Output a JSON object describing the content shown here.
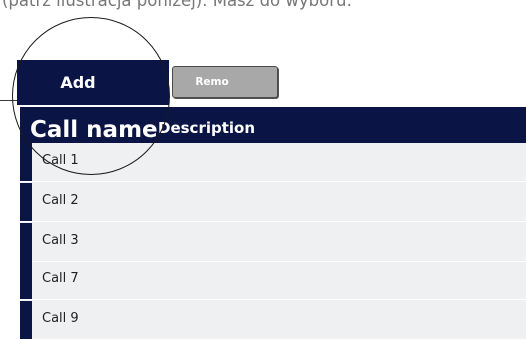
{
  "intro": {
    "text": "(patrz ilustracja poniżej). Masz do wyboru:"
  },
  "toolbar": {
    "add_label": "Add",
    "remove_label": "Remo"
  },
  "table": {
    "columns": [
      "Call name",
      "Description"
    ],
    "rows": [
      "Call 1",
      "Call 2",
      "Call 3",
      "Call 7",
      "Call 9"
    ]
  },
  "colors": {
    "header_navy": "#0b1545",
    "row_background": "#eef0f1",
    "remove_button_gray": "#a8a8a8"
  }
}
